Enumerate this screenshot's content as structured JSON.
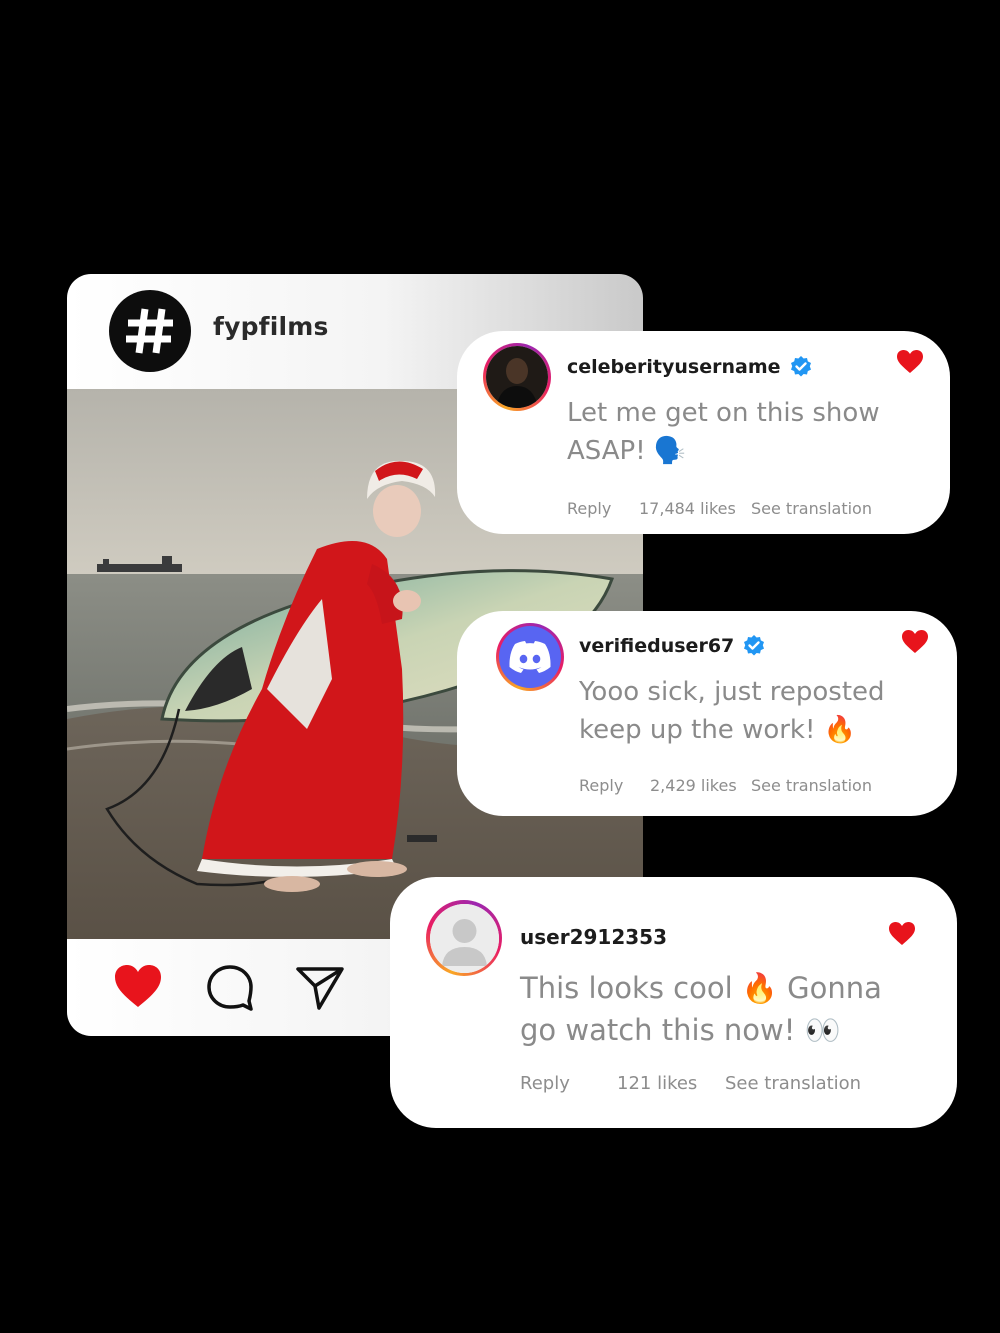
{
  "post": {
    "username": "fypfilms",
    "avatar_icon": "hashtag-icon",
    "photo_alt": "",
    "actions": {
      "like_icon": "heart-filled-icon",
      "comment_icon": "comment-bubble-icon",
      "share_icon": "paper-plane-icon"
    }
  },
  "comments": [
    {
      "username": "celeberityusername",
      "verified": true,
      "line1": "Let me get on this show",
      "line2": "ASAP! 🗣️",
      "reply_label": "Reply",
      "likes": "17,484 likes",
      "translate_label": "See translation",
      "liked": true
    },
    {
      "username": "verifieduser67",
      "verified": true,
      "line1": "Yooo sick, just reposted",
      "line2": "keep up the work! 🔥",
      "reply_label": "Reply",
      "likes": "2,429 likes",
      "translate_label": "See translation",
      "liked": true
    },
    {
      "username": "user2912353",
      "verified": false,
      "line1": "This looks cool 🔥 Gonna",
      "line2": "go watch this now! 👀",
      "reply_label": "Reply",
      "likes": "121 likes",
      "translate_label": "See translation",
      "liked": true
    }
  ],
  "colors": {
    "like_red": "#e8141c",
    "verified_blue": "#2196f3",
    "discord_blurple": "#5865f2"
  }
}
